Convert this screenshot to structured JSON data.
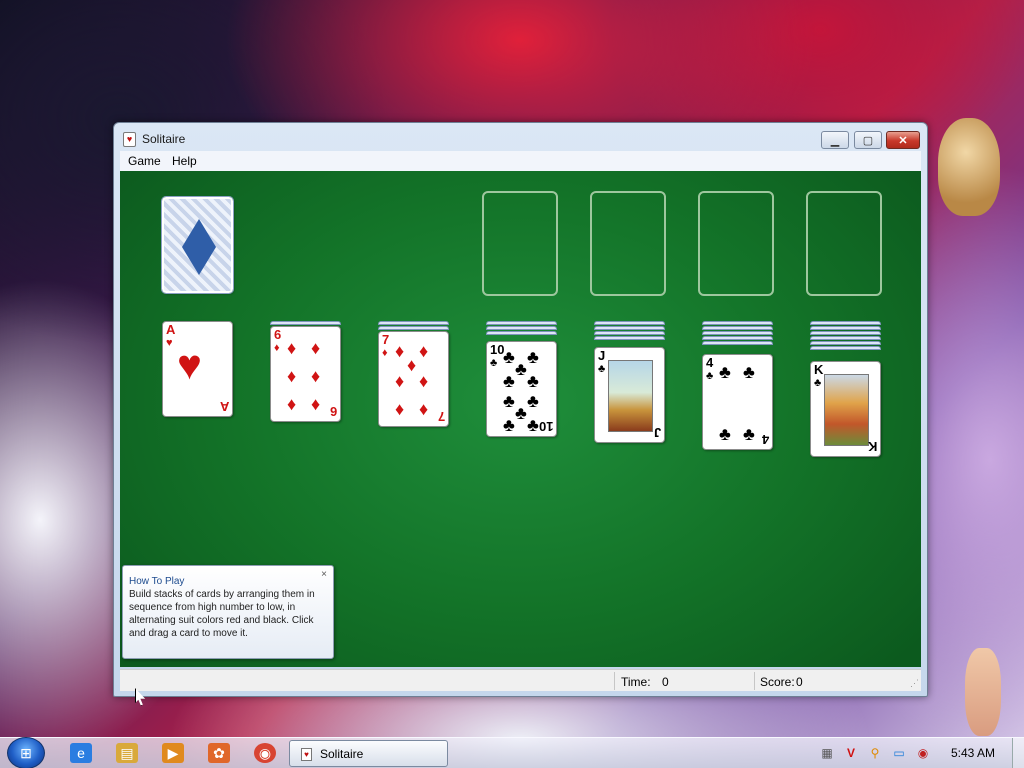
{
  "window": {
    "title": "Solitaire",
    "minimize_icon": "minimize-icon",
    "maximize_icon": "maximize-icon",
    "close_icon": "close-icon",
    "minimize_glyph": "▁",
    "maximize_glyph": "▢",
    "close_glyph": "✕"
  },
  "menu": [
    {
      "label": "Game"
    },
    {
      "label": "Help"
    }
  ],
  "game": {
    "felt_color": "#137328",
    "stock": {
      "state": "face-down"
    },
    "foundations": [
      {
        "state": "empty"
      },
      {
        "state": "empty"
      },
      {
        "state": "empty"
      },
      {
        "state": "empty"
      }
    ],
    "tableau": [
      {
        "hidden": 0,
        "top": {
          "rank": "A",
          "suit": "♥",
          "color": "red"
        }
      },
      {
        "hidden": 1,
        "top": {
          "rank": "6",
          "suit": "♦",
          "color": "red"
        }
      },
      {
        "hidden": 2,
        "top": {
          "rank": "7",
          "suit": "♦",
          "color": "red"
        }
      },
      {
        "hidden": 3,
        "top": {
          "rank": "10",
          "suit": "♣",
          "color": "black"
        }
      },
      {
        "hidden": 4,
        "top": {
          "rank": "J",
          "suit": "♣",
          "color": "black"
        }
      },
      {
        "hidden": 5,
        "top": {
          "rank": "4",
          "suit": "♣",
          "color": "black"
        }
      },
      {
        "hidden": 6,
        "top": {
          "rank": "K",
          "suit": "♣",
          "color": "black"
        }
      }
    ]
  },
  "help_tip": {
    "title": "How To Play",
    "body": "Build stacks of cards by arranging them in sequence from high number to low, in alternating suit colors red and black. Click and drag a card to move it.",
    "close_glyph": "×"
  },
  "status": {
    "time_label": "Time:",
    "time_value": "0",
    "score_label": "Score:",
    "score_value": "0"
  },
  "taskbar": {
    "start_glyph": "⊞",
    "pinned": [
      {
        "name": "internet-explorer-icon",
        "glyph": "e",
        "color": "#2a7de1"
      },
      {
        "name": "file-explorer-icon",
        "glyph": "▤",
        "color": "#d9a93a"
      },
      {
        "name": "media-player-icon",
        "glyph": "▶",
        "color": "#e08a1e"
      },
      {
        "name": "app-icon",
        "glyph": "✿",
        "color": "#e0672a"
      },
      {
        "name": "chrome-icon",
        "glyph": "◉",
        "color": "#d84432"
      }
    ],
    "task_label": "Solitaire",
    "tray": [
      {
        "name": "tray-app-icon",
        "glyph": "▦",
        "color": "#555"
      },
      {
        "name": "tray-antivirus-icon",
        "glyph": "V",
        "color": "#d01010"
      },
      {
        "name": "tray-search-icon",
        "glyph": "⚲",
        "color": "#e08a00"
      },
      {
        "name": "tray-network-icon",
        "glyph": "▭",
        "color": "#1a7ad8"
      },
      {
        "name": "tray-volume-icon",
        "glyph": "◉",
        "color": "#c02020"
      }
    ],
    "clock": "5:43 AM"
  }
}
